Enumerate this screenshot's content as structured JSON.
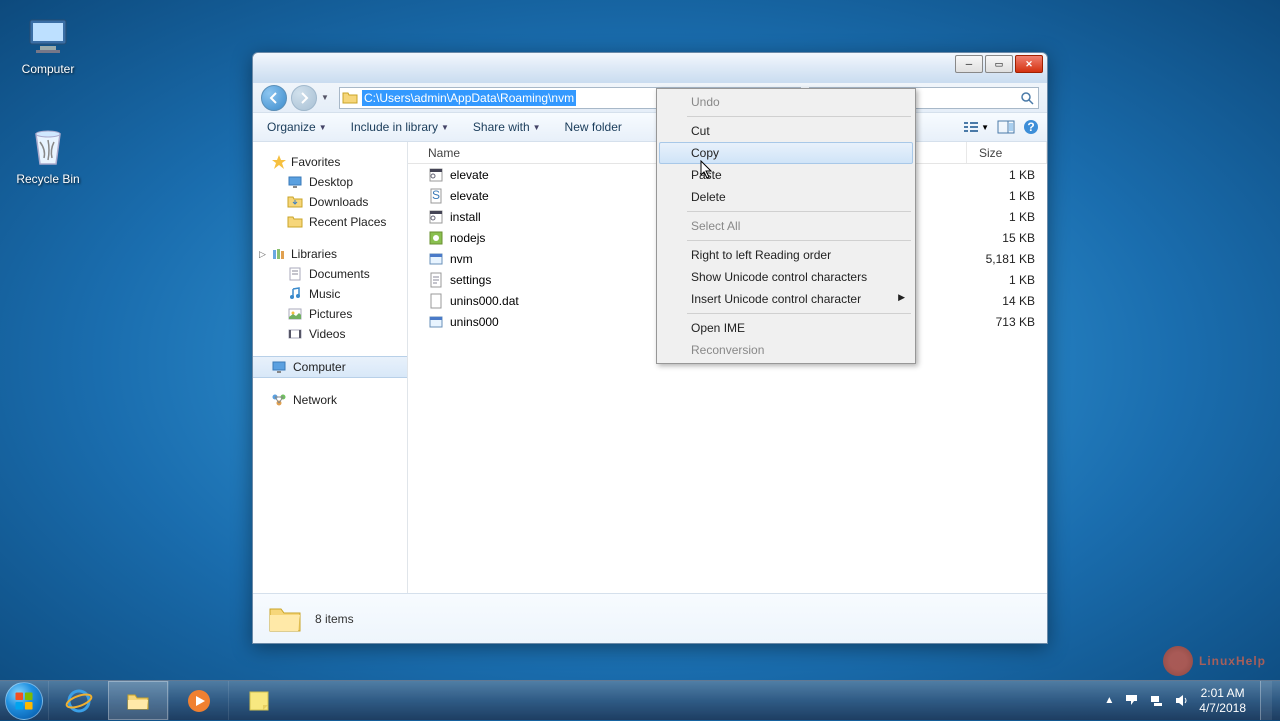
{
  "desktop": {
    "computer": "Computer",
    "recycle_bin": "Recycle Bin"
  },
  "window": {
    "address_path": "C:\\Users\\admin\\AppData\\Roaming\\nvm",
    "toolbar": {
      "organize": "Organize",
      "include": "Include in library",
      "share": "Share with",
      "newfolder": "New folder"
    },
    "columns": {
      "name": "Name",
      "size": "Size"
    },
    "sidebar": {
      "favorites": "Favorites",
      "fav_items": [
        "Desktop",
        "Downloads",
        "Recent Places"
      ],
      "libraries": "Libraries",
      "lib_items": [
        "Documents",
        "Music",
        "Pictures",
        "Videos"
      ],
      "computer": "Computer",
      "network": "Network"
    },
    "files": [
      {
        "name": "elevate",
        "size": "1 KB",
        "icon": "cmd"
      },
      {
        "name": "elevate",
        "size": "1 KB",
        "icon": "vbs"
      },
      {
        "name": "install",
        "size": "1 KB",
        "icon": "cmd"
      },
      {
        "name": "nodejs",
        "size": "15 KB",
        "icon": "ico"
      },
      {
        "name": "nvm",
        "size": "5,181 KB",
        "icon": "exe"
      },
      {
        "name": "settings",
        "size": "1 KB",
        "icon": "txt"
      },
      {
        "name": "unins000.dat",
        "size": "14 KB",
        "icon": "dat"
      },
      {
        "name": "unins000",
        "size": "713 KB",
        "icon": "exe"
      }
    ],
    "details": "8 items"
  },
  "context_menu": {
    "undo": "Undo",
    "cut": "Cut",
    "copy": "Copy",
    "paste": "Paste",
    "delete": "Delete",
    "select_all": "Select All",
    "rtl": "Right to left Reading order",
    "show_unicode": "Show Unicode control characters",
    "insert_unicode": "Insert Unicode control character",
    "open_ime": "Open IME",
    "reconversion": "Reconversion"
  },
  "tray": {
    "time": "2:01 AM",
    "date": "4/7/2018"
  },
  "watermark": "LinuxHelp"
}
